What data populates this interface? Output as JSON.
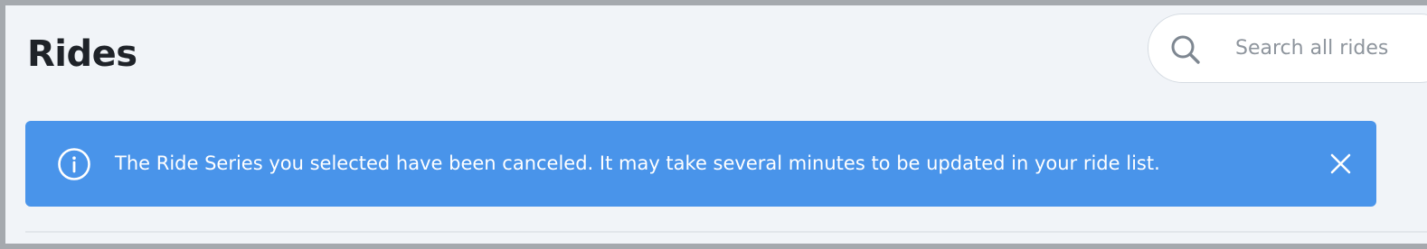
{
  "header": {
    "title": "Rides"
  },
  "search": {
    "placeholder": "Search all rides",
    "value": "",
    "icon": "search-icon"
  },
  "alert": {
    "message": "The Ride Series you selected have been canceled. It may take several minutes to be updated in your ride list.",
    "icon": "info-icon",
    "close_icon": "close-icon",
    "background": "#4994ea",
    "text_color": "#ffffff"
  },
  "colors": {
    "page_background": "#f1f4f8",
    "outer_frame": "#a5a9ae",
    "title": "#1f2329"
  }
}
